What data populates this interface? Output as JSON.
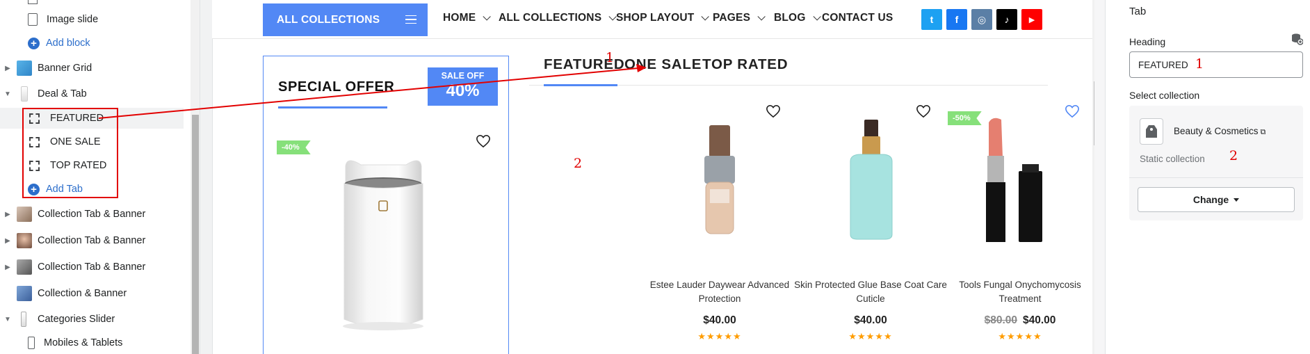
{
  "sidebar": {
    "items": [
      {
        "label": "Image slide",
        "kind": "child"
      },
      {
        "label": "Add block",
        "kind": "add"
      },
      {
        "label": "Banner Grid",
        "kind": "section"
      },
      {
        "label": "Deal & Tab",
        "kind": "section"
      },
      {
        "label": "FEATURED",
        "kind": "tab"
      },
      {
        "label": "ONE SALE",
        "kind": "tab"
      },
      {
        "label": "TOP RATED",
        "kind": "tab"
      },
      {
        "label": "Add Tab",
        "kind": "add"
      },
      {
        "label": "Collection Tab & Banner",
        "kind": "section"
      },
      {
        "label": "Collection Tab & Banner",
        "kind": "section"
      },
      {
        "label": "Collection Tab & Banner",
        "kind": "section"
      },
      {
        "label": "Collection & Banner",
        "kind": "section"
      },
      {
        "label": "Categories Slider",
        "kind": "section"
      },
      {
        "label": "Mobiles & Tablets",
        "kind": "child"
      }
    ]
  },
  "store": {
    "nav": {
      "all_collections": "ALL COLLECTIONS",
      "items": [
        "HOME",
        "ALL COLLECTIONS",
        "SHOP LAYOUT",
        "PAGES",
        "BLOG",
        "CONTACT US"
      ]
    },
    "social": [
      {
        "icon": "twitter-icon",
        "glyph": "t",
        "color": "#1da1f2"
      },
      {
        "icon": "facebook-icon",
        "glyph": "f",
        "color": "#1877f2"
      },
      {
        "icon": "instagram-icon",
        "glyph": "◎",
        "color": "#5b7fa6"
      },
      {
        "icon": "tiktok-icon",
        "glyph": "♪",
        "color": "#000000"
      },
      {
        "icon": "youtube-icon",
        "glyph": "▶",
        "color": "#ff0000"
      }
    ],
    "special_offer": {
      "title": "SPECIAL OFFER",
      "badge_line1": "SALE OFF",
      "badge_line2": "40%",
      "discount_tag": "-40%"
    },
    "tabs": [
      "FEATURED",
      "ONE SALE",
      "TOP RATED"
    ],
    "annotations": {
      "one": "1",
      "two": "2"
    },
    "products": [
      {
        "title": "Estee Lauder Daywear Advanced Protection",
        "price": "$40.00",
        "old_price": "",
        "stars": "★★★★★",
        "tag": ""
      },
      {
        "title": "Skin Protected Glue Base Coat Care Cuticle",
        "price": "$40.00",
        "old_price": "",
        "stars": "★★★★★",
        "tag": ""
      },
      {
        "title": "Tools Fungal Onychomycosis Treatment",
        "price": "$40.00",
        "old_price": "$80.00",
        "stars": "★★★★★",
        "tag": "-50%"
      }
    ]
  },
  "panel": {
    "title": "Tab",
    "heading_label": "Heading",
    "heading_value": "FEATURED",
    "select_collection_label": "Select collection",
    "collection_name": "Beauty & Cosmetics",
    "collection_type": "Static collection",
    "change_button": "Change"
  },
  "colors": {
    "accent": "#5288f5",
    "annotation": "#e20000",
    "star": "#ff9c00",
    "tag_green": "#86e07a"
  }
}
